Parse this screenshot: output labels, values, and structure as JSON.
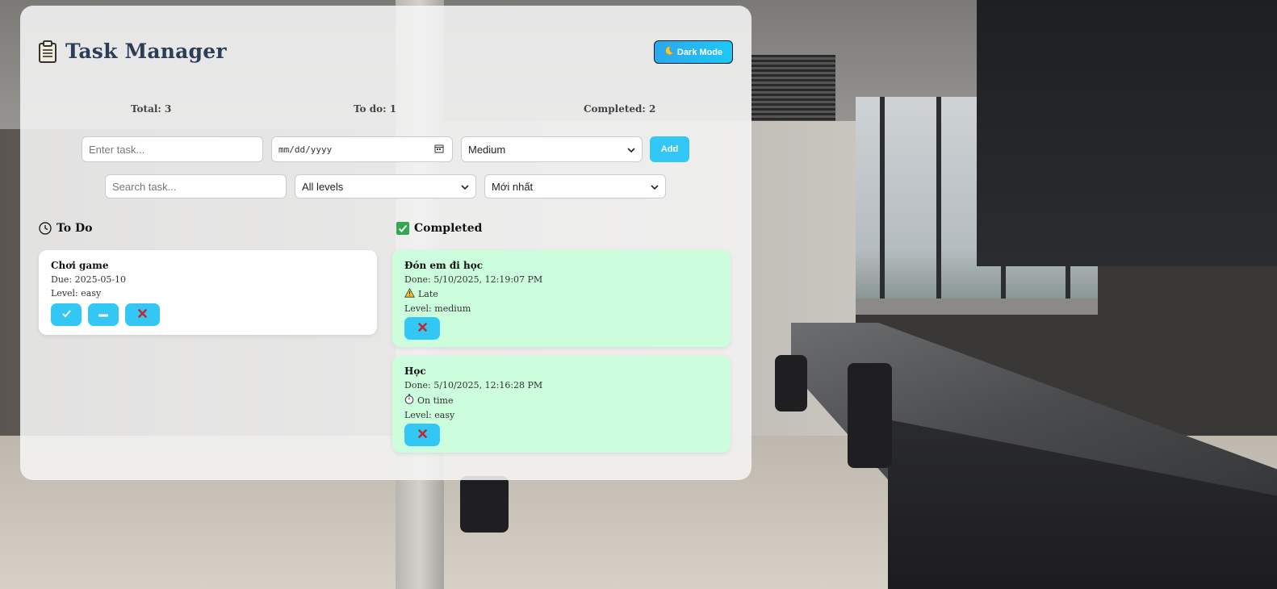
{
  "app": {
    "title": "Task Manager",
    "icon": "clipboard-icon",
    "dark_mode_label": "Dark Mode",
    "dark_mode_icon": "moon-icon"
  },
  "stats": {
    "total": "Total: 3",
    "todo": "To do: 1",
    "completed": "Completed: 2"
  },
  "form": {
    "task_placeholder": "Enter task...",
    "date_placeholder": "mm/dd/yyyy",
    "priority_selected": "Medium",
    "add_label": "Add"
  },
  "filters": {
    "search_placeholder": "Search task...",
    "level_selected": "All levels",
    "sort_selected": "Mới nhất"
  },
  "columns": {
    "todo_title": "To Do",
    "completed_title": "Completed"
  },
  "todo_tasks": [
    {
      "name": "Chơi game",
      "due": "Due: 2025-05-10",
      "level": "Level: easy"
    }
  ],
  "completed_tasks": [
    {
      "name": "Đón em đi học",
      "done": "Done: 5/10/2025, 12:19:07 PM",
      "status": "Late",
      "status_icon": "warning-icon",
      "level": "Level: medium"
    },
    {
      "name": "Học",
      "done": "Done: 5/10/2025, 12:16:28 PM",
      "status": "On time",
      "status_icon": "stopwatch-icon",
      "level": "Level: easy"
    }
  ],
  "colors": {
    "accent": "#33c7f5",
    "completed_card": "#ccfddd",
    "title": "#2c3e56",
    "delete": "#c0282f"
  }
}
